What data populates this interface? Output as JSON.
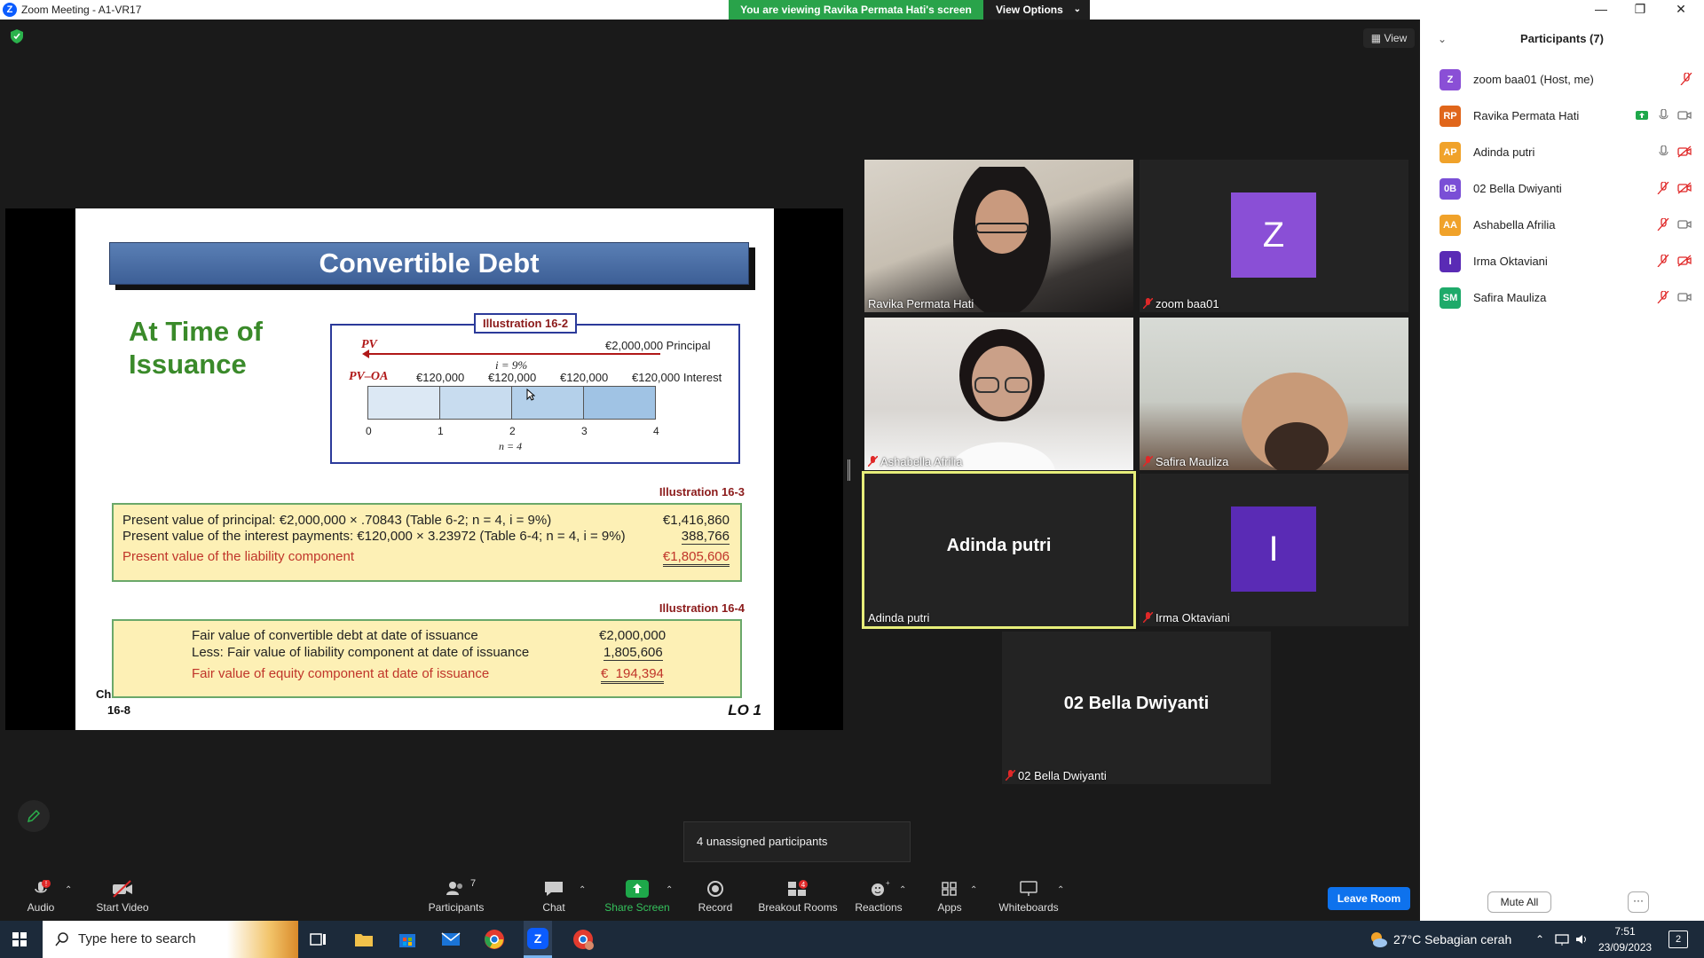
{
  "window": {
    "title": "Zoom Meeting - A1-VR17",
    "minimize": "—",
    "restore": "❐",
    "close": "✕"
  },
  "share_banner": {
    "text": "You are viewing Ravika Permata Hati's screen",
    "view_options": "View Options"
  },
  "view_button": "View",
  "slide": {
    "title": "Convertible Debt",
    "heading": "At Time of Issuance",
    "illustration_1": {
      "label": "Illustration 16-2",
      "pv": "PV",
      "principal": "€2,000,000 Principal",
      "rate": "i = 9%",
      "pvoa": "PV–OA",
      "interest": [
        "€120,000",
        "€120,000",
        "€120,000",
        "€120,000 Interest"
      ],
      "periods": [
        "0",
        "1",
        "2",
        "3",
        "4"
      ],
      "n": "n = 4"
    },
    "illustration_2": {
      "label": "Illustration 16-3",
      "rows": [
        {
          "label": "Present value of principal: €2,000,000 × .70843 (Table 6-2; n = 4, i = 9%)",
          "value": "€1,416,860"
        },
        {
          "label": "Present value of the interest payments: €120,000 × 3.23972 (Table 6-4; n = 4, i = 9%)",
          "value": "388,766"
        },
        {
          "label": "Present value of the liability component",
          "value": "€1,805,606"
        }
      ]
    },
    "illustration_3": {
      "label": "Illustration 16-4",
      "rows": [
        {
          "label": "Fair value of convertible debt at date of issuance",
          "value": "€2,000,000"
        },
        {
          "label": "Less: Fair value of liability component at date of issuance",
          "value": "1,805,606"
        },
        {
          "label": "Fair value of equity component at date of issuance",
          "value": "€  194,394"
        }
      ]
    },
    "footer_ch": "Ch",
    "footer_page": "16-8",
    "footer_lo": "LO 1"
  },
  "videos": [
    {
      "name": "Ravika Permata Hati",
      "muted": false
    },
    {
      "name": "zoom baa01",
      "muted": true,
      "avatar": "Z",
      "color": "#8a4fd6"
    },
    {
      "name": "Ashabella Afrilia",
      "muted": true
    },
    {
      "name": "Safira Mauliza",
      "muted": true
    },
    {
      "name": "Adinda putri",
      "muted": false,
      "big": "Adinda putri"
    },
    {
      "name": "Irma Oktaviani",
      "muted": true,
      "avatar": "I",
      "color": "#5a2bb5"
    },
    {
      "name": "02 Bella Dwiyanti",
      "muted": true,
      "big": "02 Bella Dwiyanti"
    }
  ],
  "toast": "4 unassigned participants",
  "toolbar": {
    "audio": "Audio",
    "start_video": "Start Video",
    "participants": "Participants",
    "participants_count": "7",
    "chat": "Chat",
    "share_screen": "Share Screen",
    "record": "Record",
    "breakout_rooms": "Breakout Rooms",
    "breakout_badge": "4",
    "reactions": "Reactions",
    "apps": "Apps",
    "whiteboards": "Whiteboards",
    "leave": "Leave Room",
    "audio_badge": "!"
  },
  "panel": {
    "title": "Participants (7)",
    "participants": [
      {
        "initials": "Z",
        "name": "zoom baa01 (Host, me)",
        "color": "#8a4fd6"
      },
      {
        "initials": "RP",
        "name": "Ravika Permata Hati",
        "color": "#e0661b"
      },
      {
        "initials": "AP",
        "name": "Adinda putri",
        "color": "#f0a22a"
      },
      {
        "initials": "0B",
        "name": "02 Bella Dwiyanti",
        "color": "#7a4fd6"
      },
      {
        "initials": "AA",
        "name": "Ashabella Afrilia",
        "color": "#f0a22a"
      },
      {
        "initials": "I",
        "name": "Irma Oktaviani",
        "color": "#5a2bb5"
      },
      {
        "initials": "SM",
        "name": "Safira Mauliza",
        "color": "#1eaa6a"
      }
    ],
    "mute_all": "Mute All",
    "more": "···"
  },
  "taskbar": {
    "search_placeholder": "Type here to search",
    "weather": "27°C  Sebagian cerah",
    "time": "7:51",
    "date": "23/09/2023",
    "notification_count": "2"
  }
}
